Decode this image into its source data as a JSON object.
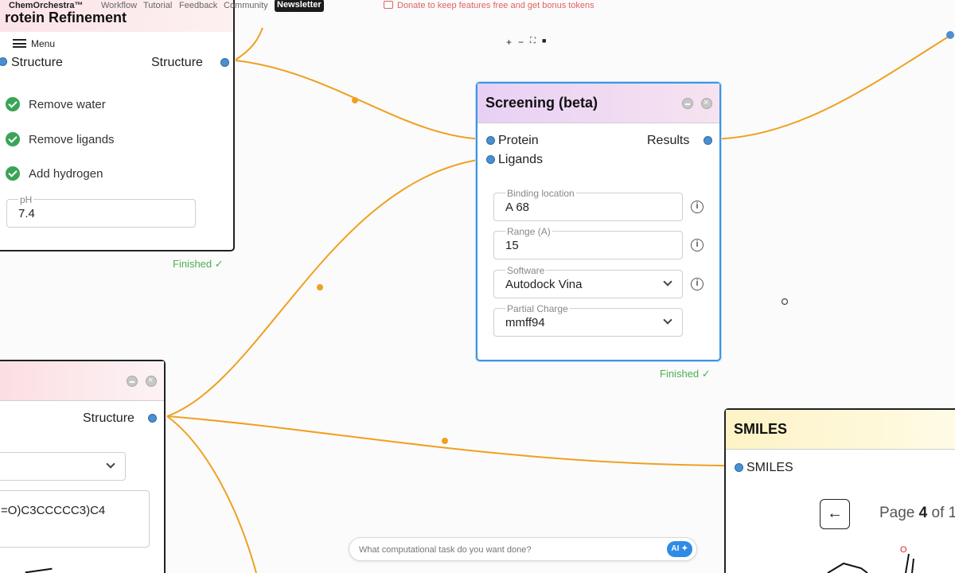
{
  "nav": {
    "brand": "ChemOrchestra™",
    "links": [
      "Workflow",
      "Tutorial",
      "Feedback",
      "Community"
    ],
    "newsletter": "Newsletter",
    "donate": "Donate to keep features free and get bonus tokens"
  },
  "canvas_controls": {
    "zoom_in": "+",
    "zoom_out": "−",
    "fit": "⛶",
    "lock": "🔒"
  },
  "refinement_node": {
    "title": "rotein Refinement",
    "menu_label": "Menu",
    "input_port": "Structure",
    "output_port": "Structure",
    "options": [
      "Remove water",
      "Remove ligands",
      "Add hydrogen"
    ],
    "ph_label": "pH",
    "ph_value": "7.4",
    "status": "Finished ✓"
  },
  "screening_node": {
    "title": "Screening (beta)",
    "inputs": [
      "Protein",
      "Ligands"
    ],
    "output": "Results",
    "fields": {
      "binding_location": {
        "label": "Binding location",
        "value": "A 68"
      },
      "range": {
        "label": "Range (A)",
        "value": "15"
      },
      "software": {
        "label": "Software",
        "value": "Autodock Vina"
      },
      "partial_charge": {
        "label": "Partial Charge",
        "value": "mmff94"
      }
    },
    "status": "Finished ✓"
  },
  "ligand_node": {
    "output_port": "Structure",
    "smiles_text": "=O)C3CCCCC3)C4"
  },
  "smiles_node": {
    "title": "SMILES",
    "input_port": "SMILES",
    "page_prefix": "Page ",
    "page_number": "4",
    "page_of": " of 1"
  },
  "chat": {
    "placeholder": "What computational task do you want done?",
    "ai_label": "AI ✦"
  },
  "colors": {
    "edge": "#f0a020",
    "port": "#4a8fcf",
    "selected_border": "#3d95e0",
    "finished": "#4caf50"
  }
}
